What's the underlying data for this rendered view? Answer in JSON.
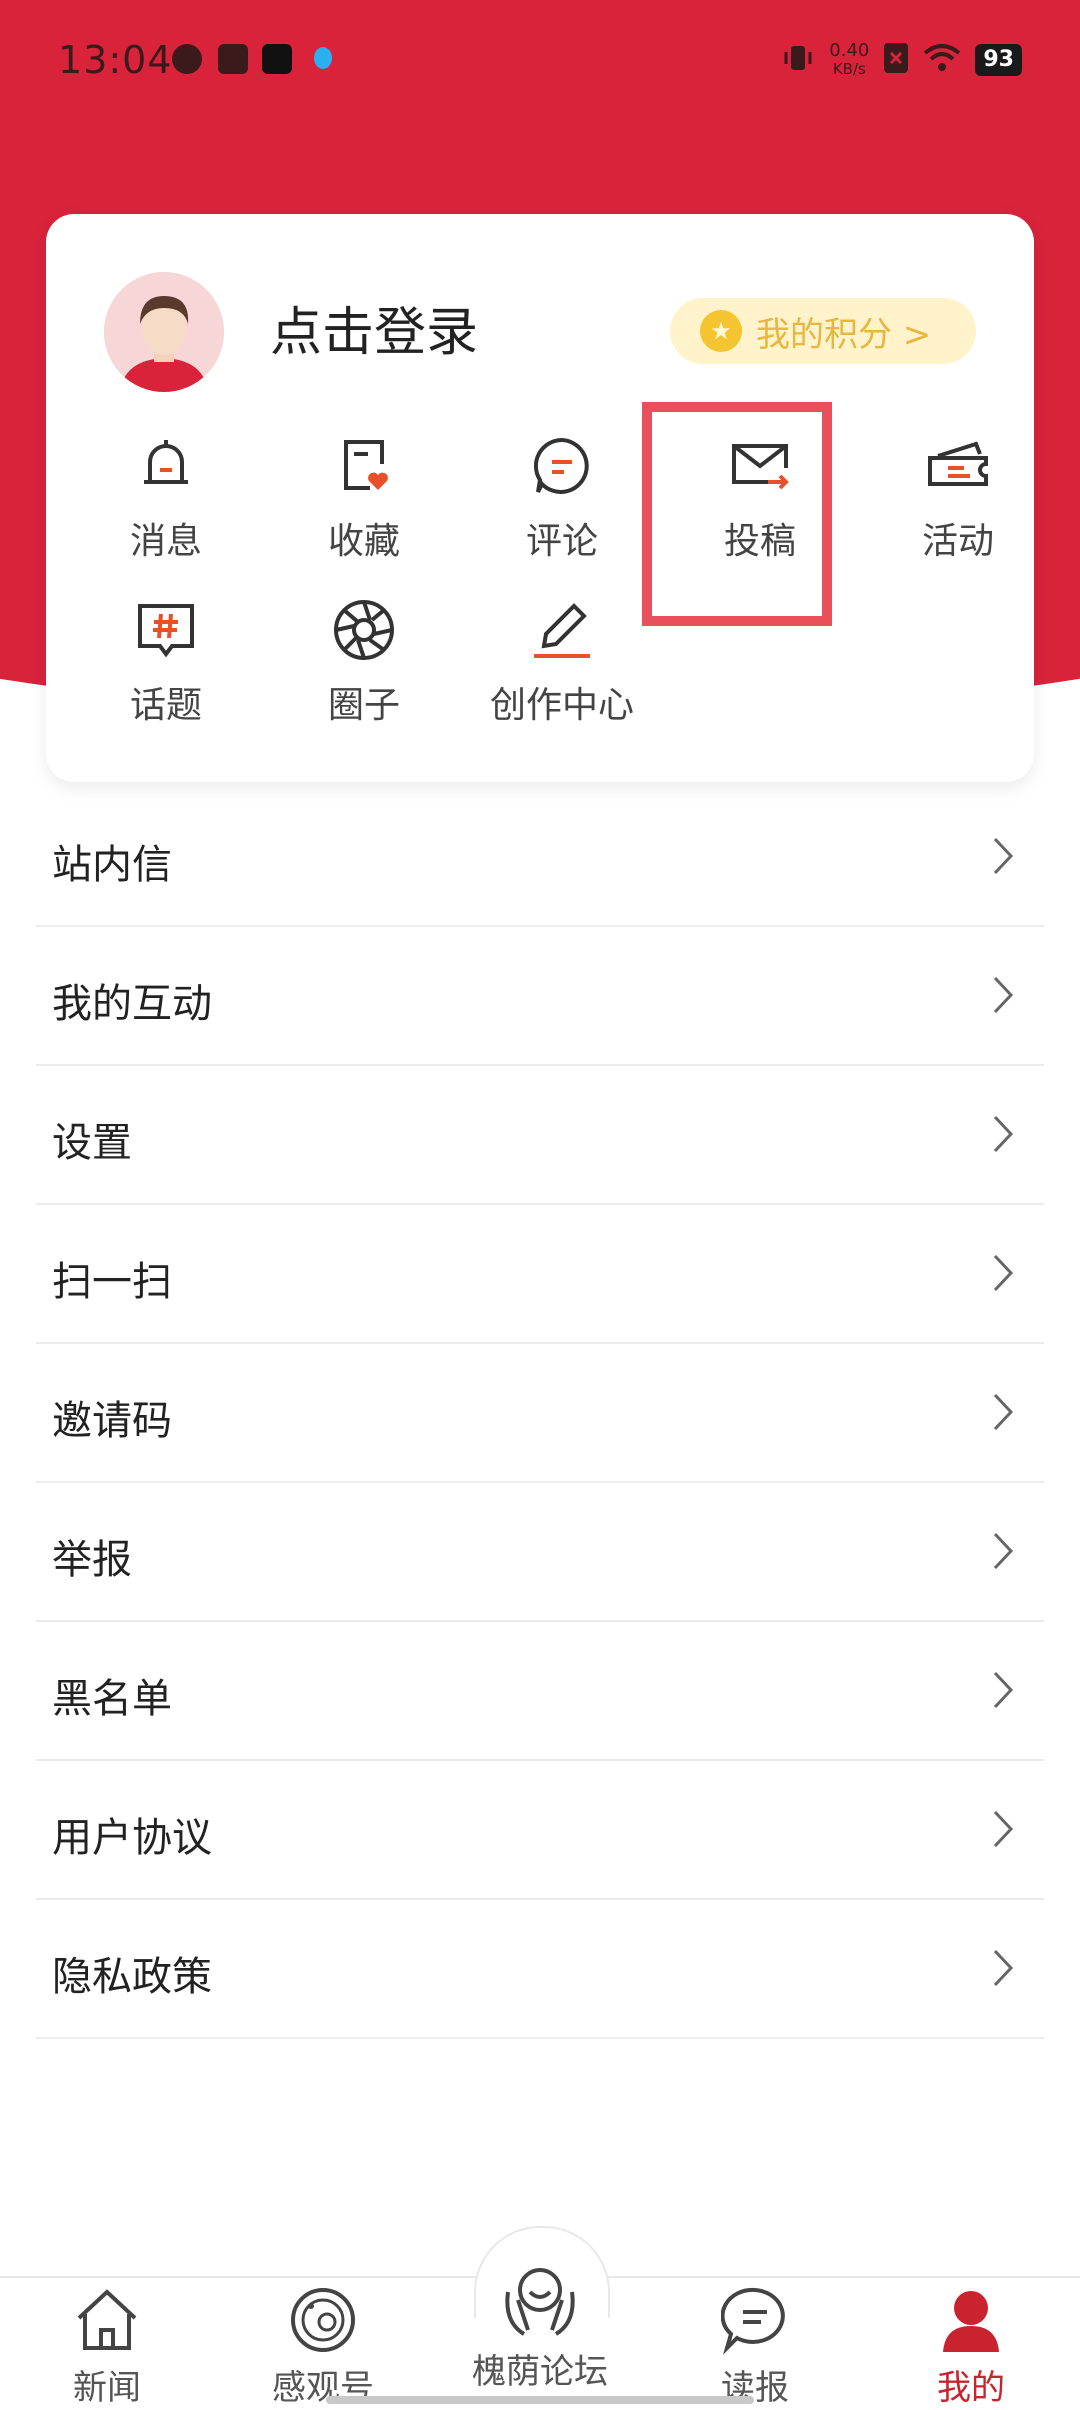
{
  "status_bar": {
    "time": "13:04",
    "net_speed": "0.40",
    "net_unit": "KB/s",
    "battery": "93"
  },
  "profile": {
    "login_label": "点击登录",
    "points_label": "我的积分 >"
  },
  "quick_actions": [
    {
      "label": "消息",
      "icon": "bell-icon"
    },
    {
      "label": "收藏",
      "icon": "favorite-note-icon"
    },
    {
      "label": "评论",
      "icon": "comment-icon"
    },
    {
      "label": "投稿",
      "icon": "mail-send-icon"
    },
    {
      "label": "活动",
      "icon": "ticket-icon"
    },
    {
      "label": "话题",
      "icon": "hashtag-icon"
    },
    {
      "label": "圈子",
      "icon": "aperture-icon"
    },
    {
      "label": "创作中心",
      "icon": "pencil-icon"
    }
  ],
  "menu": [
    "站内信",
    "我的互动",
    "设置",
    "扫一扫",
    "邀请码",
    "举报",
    "黑名单",
    "用户协议",
    "隐私政策"
  ],
  "tabs": [
    {
      "label": "新闻",
      "icon": "home-icon"
    },
    {
      "label": "感观号",
      "icon": "planet-icon"
    },
    {
      "label": "槐荫论坛",
      "icon": "forum-hands-icon"
    },
    {
      "label": "读报",
      "icon": "chat-bubble-icon"
    },
    {
      "label": "我的",
      "icon": "user-icon",
      "active": true
    }
  ],
  "colors": {
    "brand_red": "#d8233b",
    "accent_orange": "#e8502a",
    "points_gold": "#e8b73f",
    "highlight_box": "#e8505b"
  }
}
